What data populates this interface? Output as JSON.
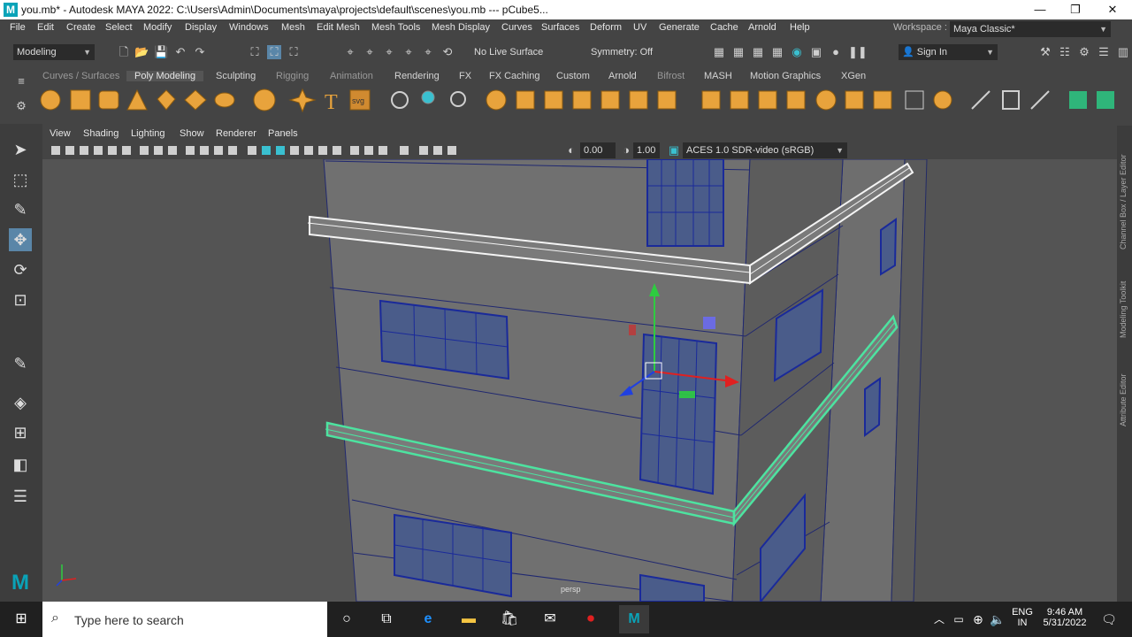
{
  "window": {
    "title": "you.mb* - Autodesk MAYA 2022: C:\\Users\\Admin\\Documents\\maya\\projects\\default\\scenes\\you.mb   ---   pCube5...",
    "logo": "M",
    "controls": [
      "minimize-icon",
      "restore-icon",
      "close-icon"
    ]
  },
  "menubar": [
    "File",
    "Edit",
    "Create",
    "Select",
    "Modify",
    "Display",
    "Windows",
    "Mesh",
    "Edit Mesh",
    "Mesh Tools",
    "Mesh Display",
    "Curves",
    "Surfaces",
    "Deform",
    "UV",
    "Generate",
    "Cache",
    "Arnold",
    "Help"
  ],
  "workspace": {
    "label": "Workspace :",
    "value": "Maya Classic*"
  },
  "statusline": {
    "mode": "Modeling",
    "live_surface": "No Live Surface",
    "symmetry": "Symmetry: Off",
    "sign_in": "Sign In"
  },
  "shelf": {
    "tabs": [
      "Curves / Surfaces",
      "Poly Modeling",
      "Sculpting",
      "Rigging",
      "Animation",
      "Rendering",
      "FX",
      "FX Caching",
      "Custom",
      "Arnold",
      "Bifrost",
      "MASH",
      "Motion Graphics",
      "XGen"
    ],
    "active": "Poly Modeling",
    "text_icon": "T",
    "svg_icon": "svg"
  },
  "panel": {
    "menus": [
      "View",
      "Shading",
      "Lighting",
      "Show",
      "Renderer",
      "Panels"
    ],
    "exposure": "0.00",
    "gamma": "1.00",
    "color_space": "ACES 1.0 SDR-video (sRGB)",
    "camera_label": "persp"
  },
  "right_tabs": [
    "Channel Box / Layer Editor",
    "Modeling Toolkit",
    "Attribute Editor"
  ],
  "taskbar": {
    "search_placeholder": "Type here to search",
    "lang_top": "ENG",
    "lang_bottom": "IN",
    "time": "9:46 AM",
    "date": "5/31/2022"
  },
  "colors": {
    "accent_orange": "#e8a33c",
    "selection_green": "#4de3a0",
    "window_blue": "#1a2a9a",
    "maya_teal": "#0aa3b8"
  }
}
